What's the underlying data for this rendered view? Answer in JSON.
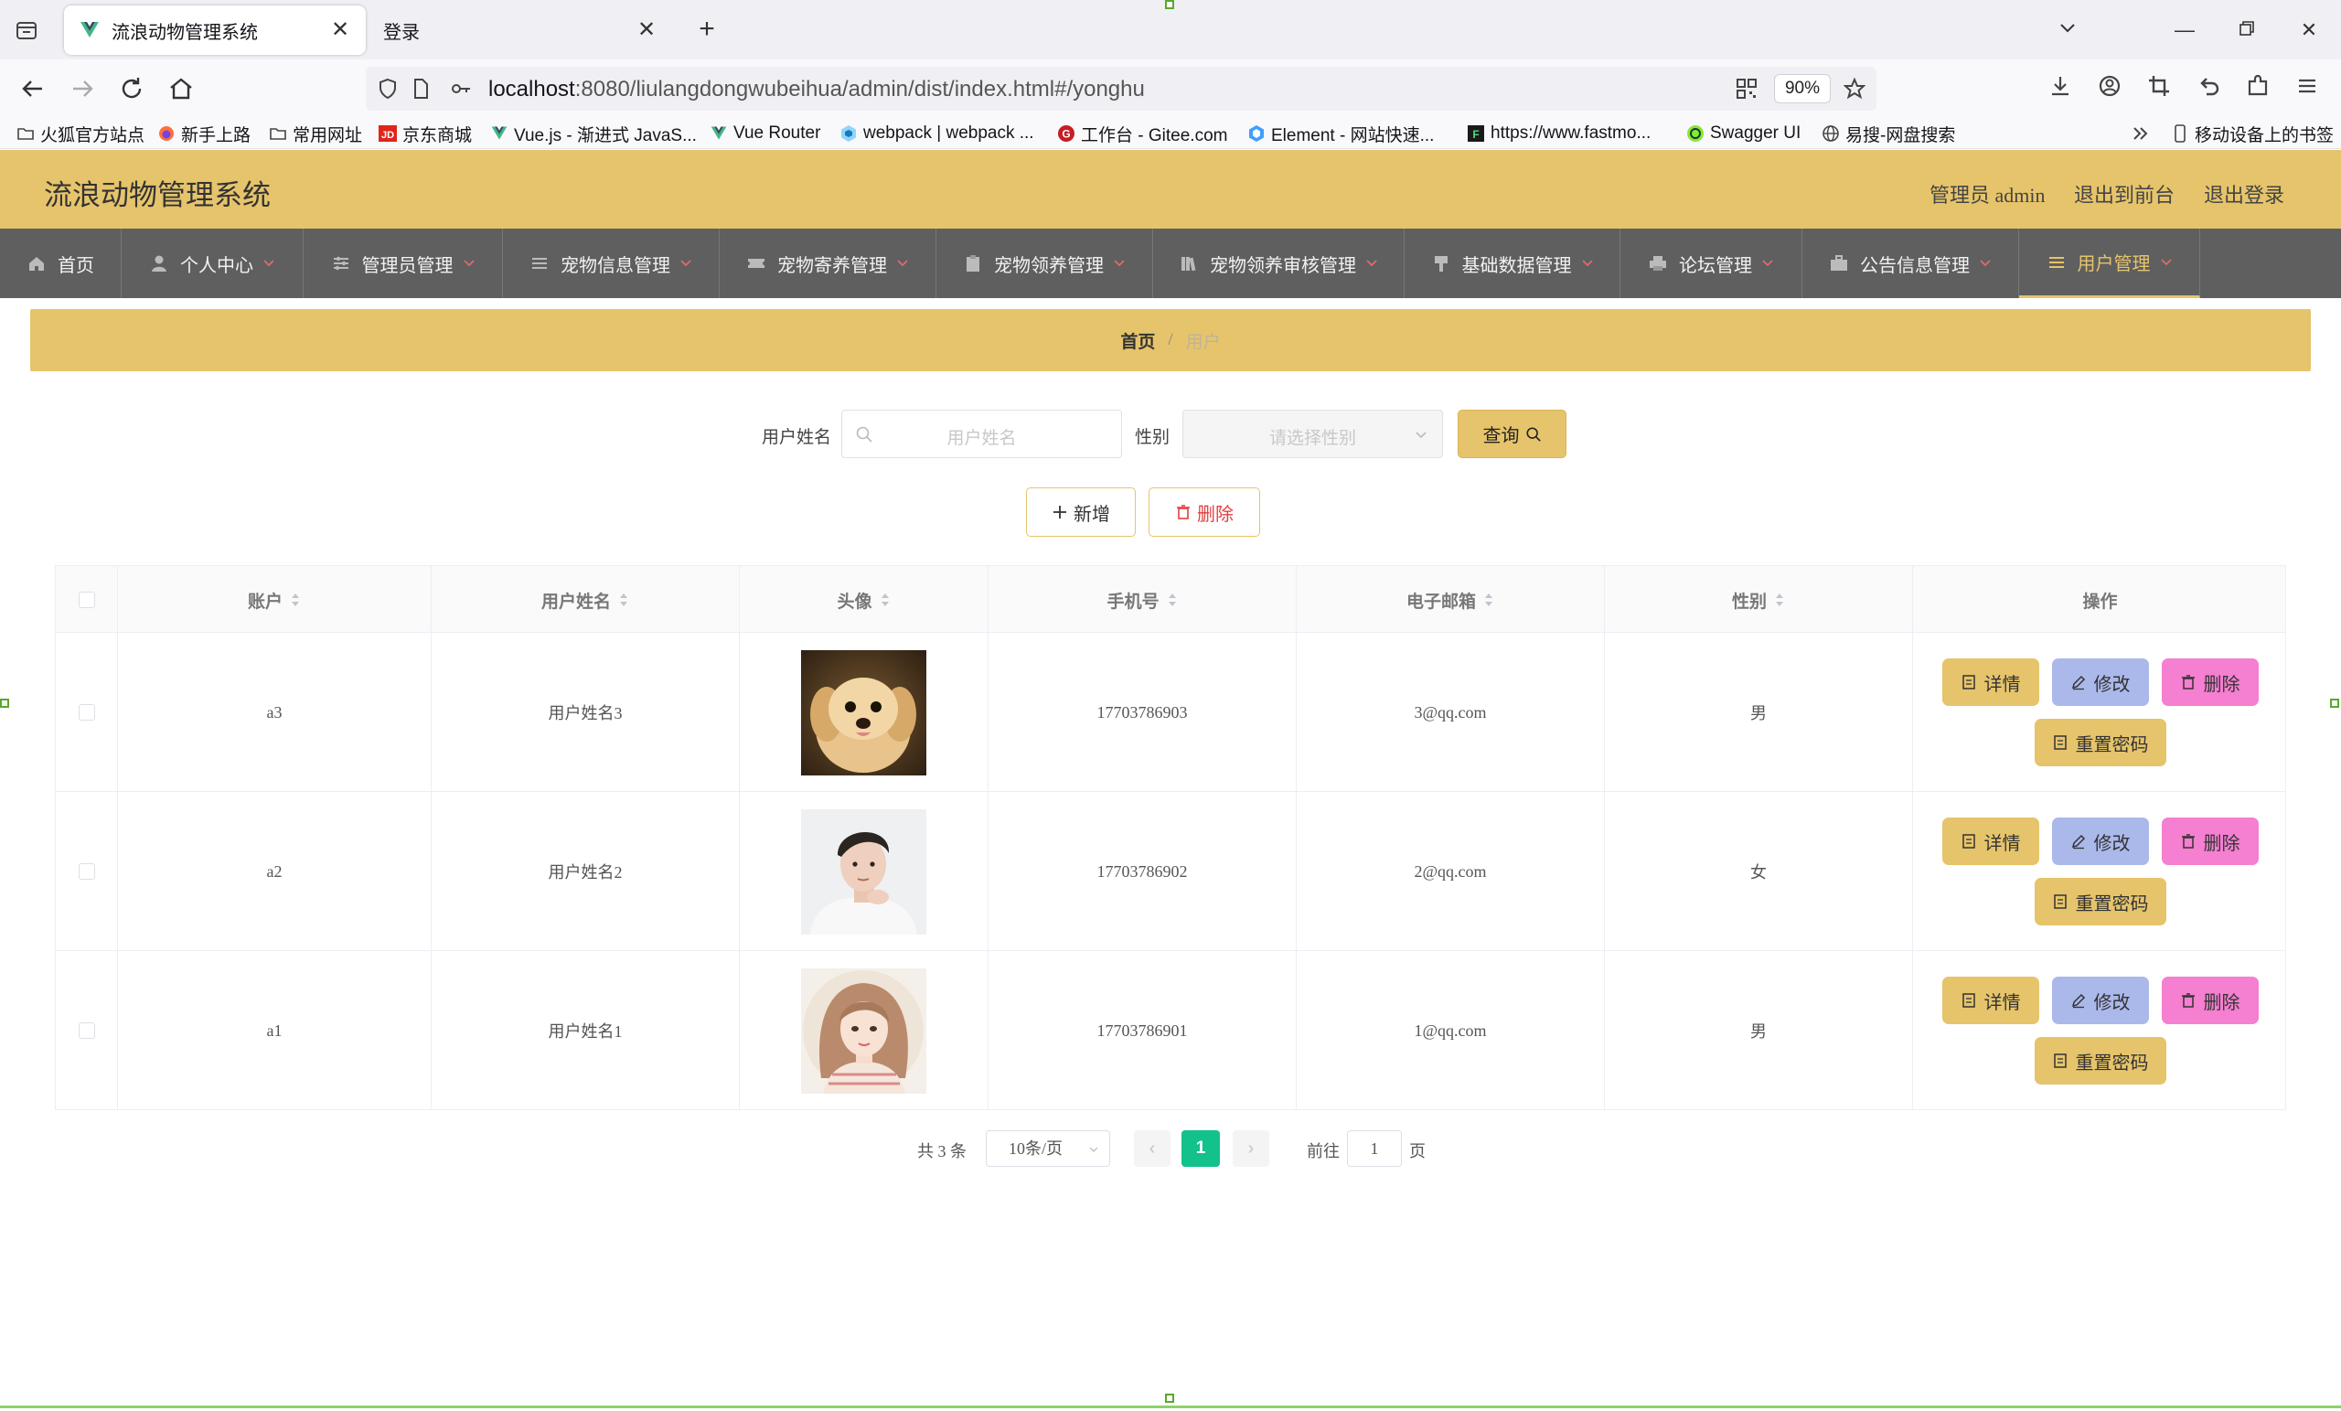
{
  "browser": {
    "tabs": [
      {
        "title": "流浪动物管理系统",
        "active": true
      },
      {
        "title": "登录",
        "active": false
      }
    ],
    "url_host": "localhost",
    "url_rest": ":8080/liulangdongwubeihua/admin/dist/index.html#/yonghu",
    "zoom": "90%",
    "bookmarks": [
      "火狐官方站点",
      "新手上路",
      "常用网址",
      "京东商城",
      "Vue.js - 渐进式 JavaS...",
      "Vue Router",
      "webpack | webpack ...",
      "工作台 - Gitee.com",
      "Element - 网站快速...",
      "https://www.fastmo...",
      "Swagger UI",
      "易搜-网盘搜索"
    ],
    "mobile_bookmarks": "移动设备上的书签"
  },
  "app": {
    "title": "流浪动物管理系统",
    "role_label": "管理员 admin",
    "front_link": "退出到前台",
    "logout_link": "退出登录",
    "accent": "#e6c46b"
  },
  "menu": [
    {
      "label": "首页",
      "icon": "home-icon"
    },
    {
      "label": "个人中心",
      "icon": "user-icon"
    },
    {
      "label": "管理员管理",
      "icon": "sliders-icon"
    },
    {
      "label": "宠物信息管理",
      "icon": "list-icon"
    },
    {
      "label": "宠物寄养管理",
      "icon": "ticket-icon"
    },
    {
      "label": "宠物领养管理",
      "icon": "clipboard-icon"
    },
    {
      "label": "宠物领养审核管理",
      "icon": "books-icon"
    },
    {
      "label": "基础数据管理",
      "icon": "brush-icon"
    },
    {
      "label": "论坛管理",
      "icon": "printer-icon"
    },
    {
      "label": "公告信息管理",
      "icon": "briefcase-icon"
    },
    {
      "label": "用户管理",
      "icon": "list-icon",
      "active": true
    }
  ],
  "breadcrumb": {
    "home": "首页",
    "separator": "/",
    "current": "用户"
  },
  "search": {
    "name_label": "用户姓名",
    "name_placeholder": "用户姓名",
    "gender_label": "性别",
    "gender_placeholder": "请选择性别",
    "query_label": "查询"
  },
  "actions": {
    "add_label": "新增",
    "delete_label": "删除"
  },
  "table": {
    "columns": [
      "账户",
      "用户姓名",
      "头像",
      "手机号",
      "电子邮箱",
      "性别",
      "操作"
    ],
    "rows": [
      {
        "account": "a3",
        "name": "用户姓名3",
        "avatar": "puppy-photo",
        "phone": "17703786903",
        "email": "3@qq.com",
        "gender": "男"
      },
      {
        "account": "a2",
        "name": "用户姓名2",
        "avatar": "man-photo",
        "phone": "17703786902",
        "email": "2@qq.com",
        "gender": "女"
      },
      {
        "account": "a1",
        "name": "用户姓名1",
        "avatar": "woman-illustration",
        "phone": "17703786901",
        "email": "1@qq.com",
        "gender": "男"
      }
    ],
    "row_actions": {
      "detail": "详情",
      "edit": "修改",
      "delete": "删除",
      "reset": "重置密码"
    }
  },
  "pager": {
    "total": "共 3 条",
    "page_size": "10条/页",
    "current": "1",
    "goto_prefix": "前往",
    "goto_value": "1",
    "goto_suffix": "页"
  }
}
